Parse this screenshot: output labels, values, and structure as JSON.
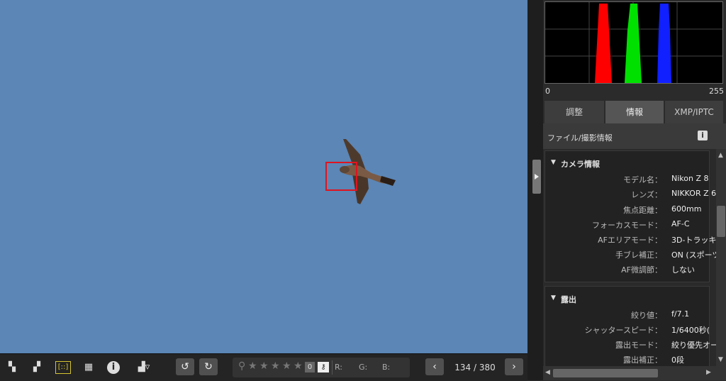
{
  "histogram": {
    "min_label": "0",
    "max_label": "255"
  },
  "tabs": [
    {
      "label": "調整",
      "active": false
    },
    {
      "label": "情報",
      "active": true
    },
    {
      "label": "XMP/IPTC",
      "active": false
    }
  ],
  "info_panel": {
    "title": "ファイル/撮影情報",
    "sections": [
      {
        "title": "カメラ情報",
        "rows": [
          {
            "label": "モデル名：",
            "value": "Nikon Z 8"
          },
          {
            "label": "レンズ：",
            "value": "NIKKOR Z 6"
          },
          {
            "label": "焦点距離：",
            "value": "600mm"
          },
          {
            "label": "フォーカスモード：",
            "value": "AF-C"
          },
          {
            "label": "AFエリアモード：",
            "value": "3D-トラッキン"
          },
          {
            "label": "手ブレ補正：",
            "value": "ON (スポーツ"
          },
          {
            "label": "AF微調節：",
            "value": "しない"
          }
        ]
      },
      {
        "title": "露出",
        "rows": [
          {
            "label": "絞り値：",
            "value": "f/7.1"
          },
          {
            "label": "シャッタースピード：",
            "value": "1/6400秒("
          },
          {
            "label": "露出モード：",
            "value": "絞り優先オー"
          },
          {
            "label": "露出補正：",
            "value": "0段"
          }
        ]
      }
    ]
  },
  "toolbar": {
    "rating_count": "0",
    "rgb": {
      "r": "R:",
      "g": "G:",
      "b": "B:"
    },
    "counter": "134 / 380"
  },
  "colors": {
    "sky": "#5b86b6",
    "focus_box": "#e0141e",
    "hist_red": "#ff0000",
    "hist_green": "#00e000",
    "hist_blue": "#1020ff"
  }
}
